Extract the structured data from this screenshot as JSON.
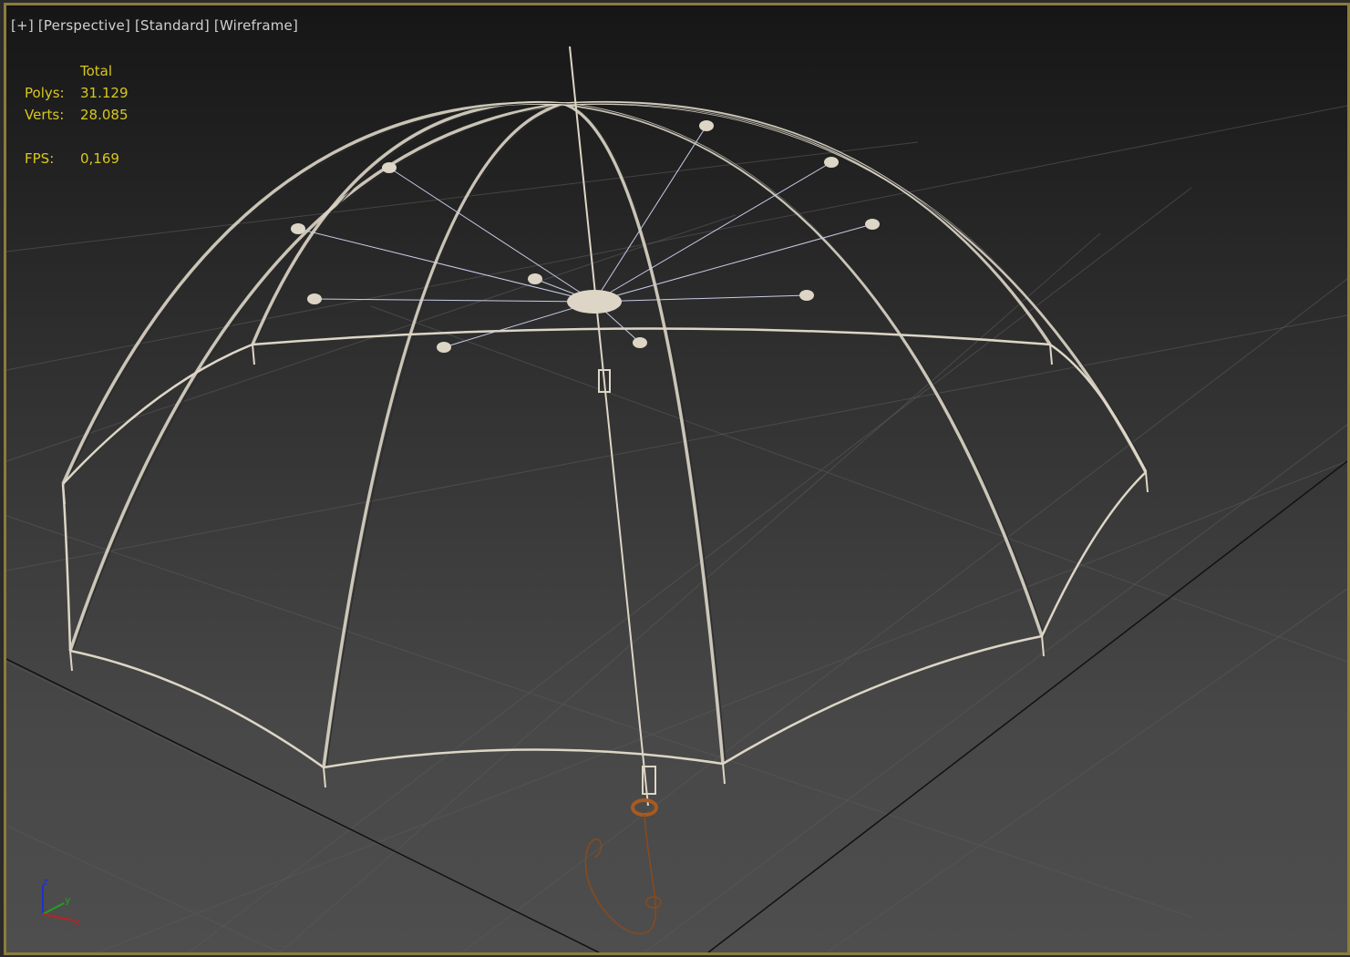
{
  "viewport": {
    "labels": [
      "[+]",
      "[Perspective]",
      "[Standard]",
      "[Wireframe]"
    ],
    "stats": {
      "header": "Total",
      "polys_label": "Polys:",
      "polys": "31.129",
      "verts_label": "Verts:",
      "verts": "28.085",
      "fps_label": "FPS:",
      "fps": "0,169"
    },
    "axis": {
      "x": "x",
      "y": "y",
      "z": "z"
    },
    "colors": {
      "border": "#8c7c3c",
      "stats_text": "#d8c81c",
      "wire": "#ddd6c6",
      "handle": "#8a4a1c"
    }
  }
}
